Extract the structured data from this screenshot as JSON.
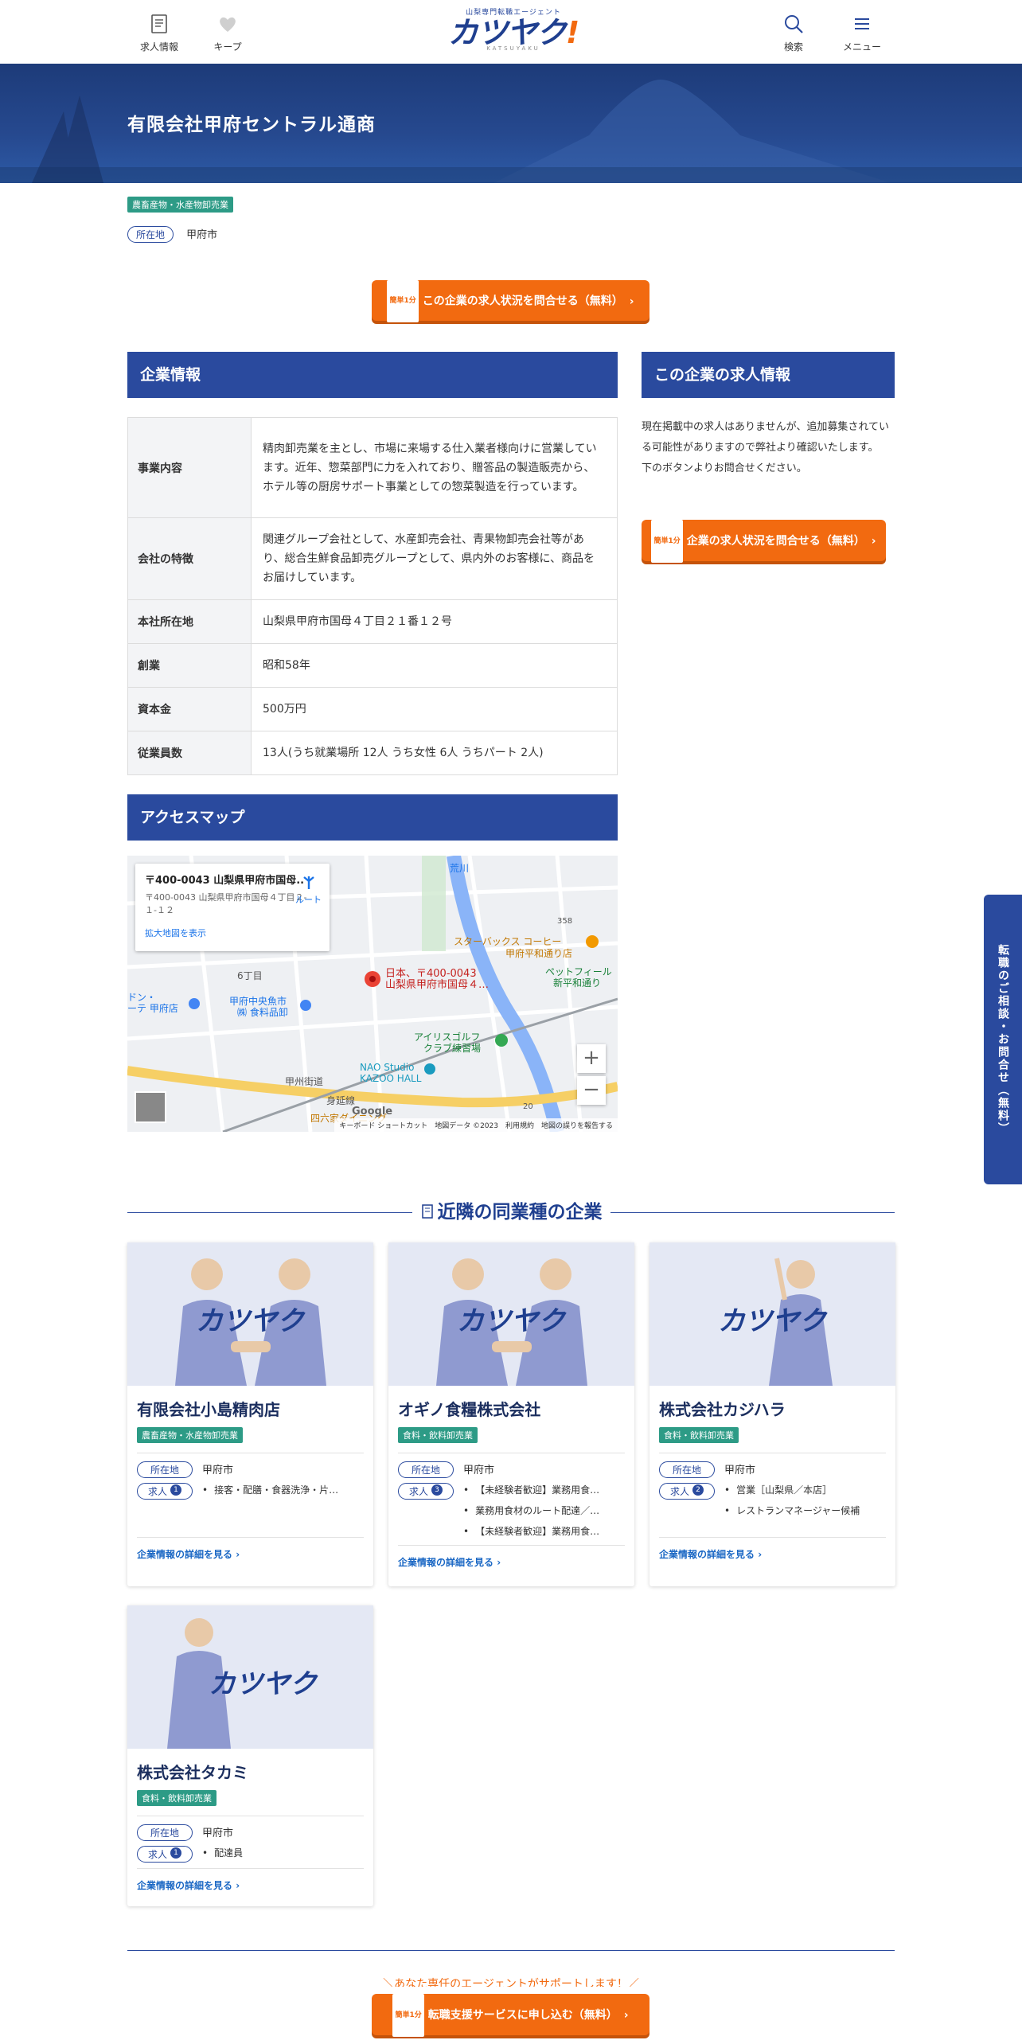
{
  "header": {
    "nav_left": [
      {
        "label": "求人情報",
        "icon": "document-icon"
      },
      {
        "label": "キープ",
        "icon": "heart-icon"
      }
    ],
    "logo": {
      "tagline": "山梨専門転職エージェント",
      "text": "カツヤク",
      "mark": "!",
      "sub": "KATSUYAKU"
    },
    "nav_right": [
      {
        "label": "検索",
        "icon": "search-icon"
      },
      {
        "label": "メニュー",
        "icon": "menu-icon"
      }
    ]
  },
  "hero": {
    "company_name": "有限会社甲府セントラル通商"
  },
  "company": {
    "industry": "農畜産物・水産物卸売業",
    "location_label": "所在地",
    "location": "甲府市"
  },
  "cta_top": {
    "badge": "簡単1分",
    "label": "この企業の求人状況を問合せる（無料）",
    "arrow": "›"
  },
  "company_info": {
    "heading": "企業情報",
    "rows": [
      {
        "label": "事業内容",
        "value": "精肉卸売業を主とし、市場に来場する仕入業者様向けに営業しています。近年、惣菜部門に力を入れており、贈答品の製造販売から、ホテル等の厨房サポート事業としての惣菜製造を行っています。"
      },
      {
        "label": "会社の特徴",
        "value": "関連グループ会社として、水産卸売会社、青果物卸売会社等があり、総合生鮮食品卸売グループとして、県内外のお客様に、商品をお届けしています。"
      },
      {
        "label": "本社所在地",
        "value": "山梨県甲府市国母４丁目２１番１２号"
      },
      {
        "label": "創業",
        "value": "昭和58年"
      },
      {
        "label": "資本金",
        "value": "500万円"
      },
      {
        "label": "従業員数",
        "value": "13人(うち就業場所 12人 うち女性 6人 うちパート 2人)"
      }
    ]
  },
  "access_map": {
    "heading": "アクセスマップ",
    "card_title": "〒400-0043 山梨県甲府市国母...",
    "card_address": "〒400-0043 山梨県甲府市国母４丁目２-１-１２",
    "card_link": "拡大地図を表示",
    "route_label": "ルート",
    "pin_label_1": "日本、〒400-0043",
    "pin_label_2": "山梨県甲府市国母４…",
    "places": [
      "スターバックス コーヒー",
      "甲府平和通り店",
      "ペットフィール",
      "新平和通り",
      "6丁目",
      "甲府中央魚市",
      "㈱ 食料品卸",
      "アイリスゴルフ",
      "クラブ練習場",
      "NAO Studio",
      "KAZOO HALL",
      "甲州街道",
      "荒川",
      "ドン・",
      "ーテ 甲府店",
      "身延線",
      "四六家ダイニング"
    ],
    "road_numbers": [
      "358",
      "20"
    ],
    "zoom_in": "+",
    "zoom_out": "−",
    "google": "Google",
    "footer": "キーボード ショートカット　地図データ ©2023　利用規約　地図の誤りを報告する"
  },
  "jobs_side": {
    "heading": "この企業の求人情報",
    "text1": "現在掲載中の求人はありませんが、追加募集されている可能性がありますので弊社より確認いたします。",
    "text2": "下のボタンよりお問合せください。",
    "cta_badge": "簡単1分",
    "cta_label": "企業の求人状況を問合せる（無料）",
    "cta_arrow": "›"
  },
  "side_tab": {
    "label": "転職のご相談・お問合せ（無料）"
  },
  "nearby": {
    "title": "近隣の同業種の企業",
    "location_label": "所在地",
    "jobs_label": "求人",
    "more_label": "企業情報の詳細を見る",
    "more_arrow": "›",
    "cards": [
      {
        "name": "有限会社小島精肉店",
        "industry": "農畜産物・水産物卸売業",
        "location": "甲府市",
        "job_count": "1",
        "jobs": [
          "接客・配膳・食器洗浄・片…"
        ]
      },
      {
        "name": "オギノ食糧株式会社",
        "industry": "食料・飲料卸売業",
        "location": "甲府市",
        "job_count": "3",
        "jobs": [
          "【未経験者歓迎】業務用食…",
          "業務用食材のルート配達／…",
          "【未経験者歓迎】業務用食…"
        ]
      },
      {
        "name": "株式会社カジハラ",
        "industry": "食料・飲料卸売業",
        "location": "甲府市",
        "job_count": "2",
        "jobs": [
          "営業［山梨県／本店］",
          "レストランマネージャー候補"
        ]
      },
      {
        "name": "株式会社タカミ",
        "industry": "食料・飲料卸売業",
        "location": "甲府市",
        "job_count": "1",
        "jobs": [
          "配達員"
        ]
      }
    ]
  },
  "bottom": {
    "teaser": "＼あなた専任のエージェントがサポートします！／",
    "cta_badge": "簡単1分",
    "cta_label": "転職支援サービスに申し込む（無料）",
    "cta_arrow": "›"
  },
  "colors": {
    "brand": "#2a4a9e",
    "accent": "#f26a10",
    "industry_badge": "#2d9b86"
  }
}
